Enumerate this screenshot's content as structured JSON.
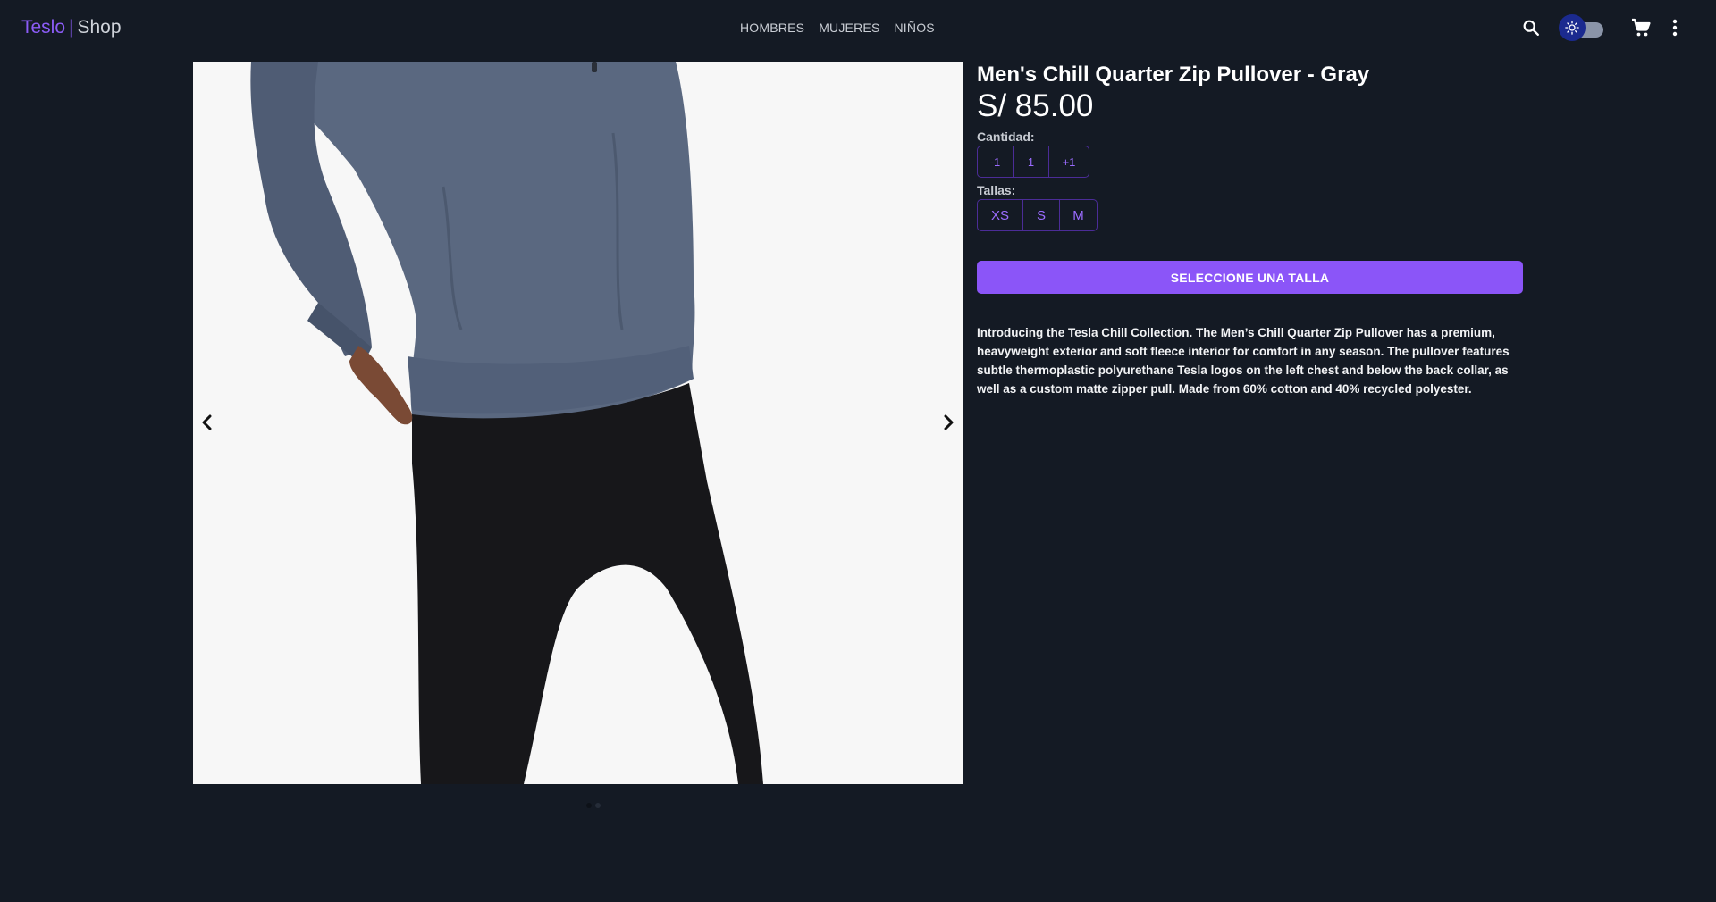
{
  "header": {
    "logo_brand": "Teslo",
    "logo_separator": "|",
    "logo_shop": "Shop",
    "nav": [
      "HOMBRES",
      "MUJERES",
      "NIÑOS"
    ],
    "icons": [
      "search-icon",
      "theme-toggle-sun-icon",
      "cart-icon",
      "more-vert-icon"
    ]
  },
  "product": {
    "title": "Men's Chill Quarter Zip Pullover - Gray",
    "price": "S/ 85.00",
    "quantity_label": "Cantidad:",
    "quantity": {
      "decrement": "-1",
      "value": "1",
      "increment": "+1"
    },
    "sizes_label": "Tallas:",
    "sizes": [
      "XS",
      "S",
      "M"
    ],
    "cta_label": "SELECCIONE UNA TALLA",
    "description": "Introducing the Tesla Chill Collection. The Men’s Chill Quarter Zip Pullover has a premium, heavyweight exterior and soft fleece interior for comfort in any season. The pullover features subtle thermoplastic polyurethane Tesla logos on the left chest and below the back collar, as well as a custom matte zipper pull. Made from 60% cotton and 40% recycled polyester."
  },
  "slider": {
    "slide_count": 2,
    "active_slide": 1,
    "arrows": [
      "chevron-left-icon",
      "chevron-right-icon"
    ]
  },
  "colors": {
    "background": "#141a24",
    "accent": "#8b55f8",
    "toggle_knob": "#1b2a8f"
  }
}
